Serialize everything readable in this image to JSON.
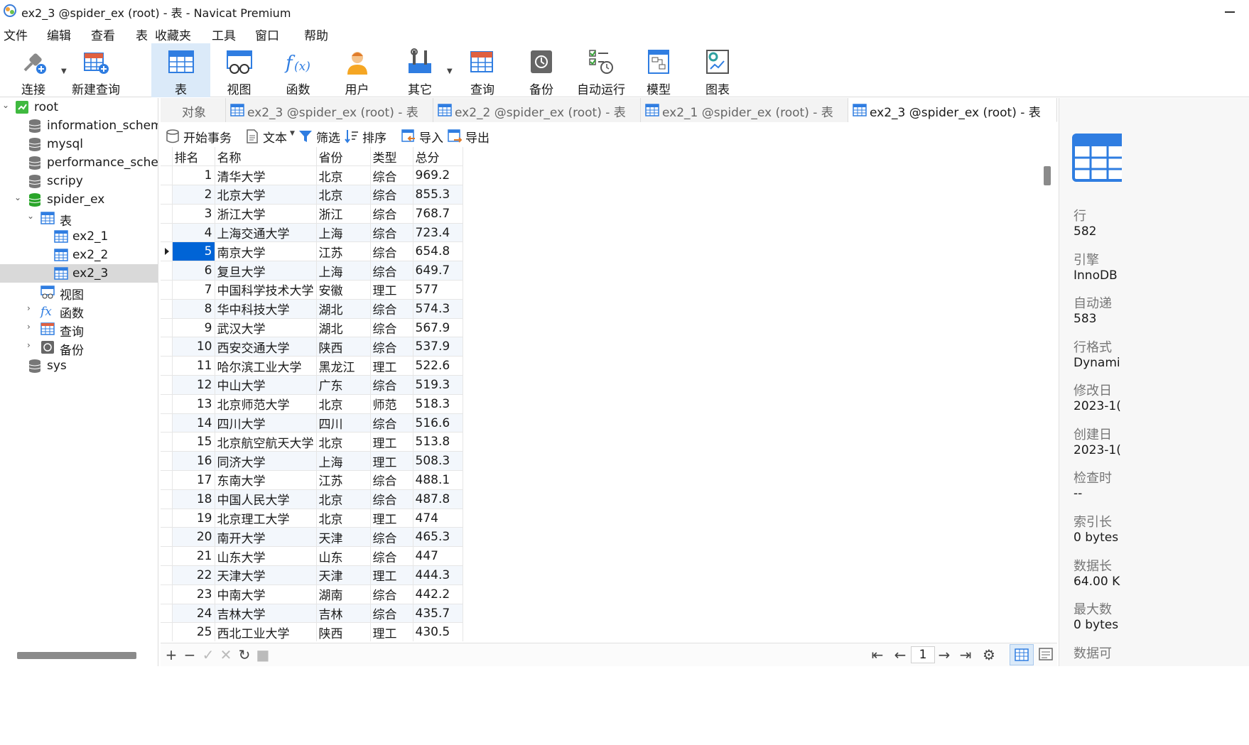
{
  "window": {
    "title": "ex2_3 @spider_ex (root) - 表 - Navicat Premium"
  },
  "menu": [
    "文件",
    "编辑",
    "查看",
    "表",
    "收藏夹",
    "工具",
    "窗口",
    "帮助"
  ],
  "toolbar": {
    "connect": "连接",
    "new_query": "新建查询",
    "table": "表",
    "view": "视图",
    "function": "函数",
    "user": "用户",
    "other": "其它",
    "query": "查询",
    "backup": "备份",
    "automation": "自动运行",
    "model": "模型",
    "chart": "图表"
  },
  "tree": {
    "root": "root",
    "dbs": [
      "information_schema",
      "mysql",
      "performance_schema",
      "scripy"
    ],
    "spider_ex": "spider_ex",
    "tables_group": "表",
    "tables": [
      "ex2_1",
      "ex2_2",
      "ex2_3"
    ],
    "views": "视图",
    "functions": "函数",
    "queries": "查询",
    "backups": "备份",
    "sys": "sys"
  },
  "tabs": {
    "objects": "对象",
    "t1": "ex2_3 @spider_ex (root) - 表",
    "t2": "ex2_2 @spider_ex (root) - 表",
    "t3": "ex2_1 @spider_ex (root) - 表",
    "t4": "ex2_3 @spider_ex (root) - 表"
  },
  "subtoolbar": {
    "begin_tx": "开始事务",
    "text": "文本",
    "filter": "筛选",
    "sort": "排序",
    "import": "导入",
    "export": "导出"
  },
  "grid": {
    "columns": [
      "排名",
      "名称",
      "省份",
      "类型",
      "总分"
    ],
    "rows": [
      [
        "1",
        "清华大学",
        "北京",
        "综合",
        "969.2"
      ],
      [
        "2",
        "北京大学",
        "北京",
        "综合",
        "855.3"
      ],
      [
        "3",
        "浙江大学",
        "浙江",
        "综合",
        "768.7"
      ],
      [
        "4",
        "上海交通大学",
        "上海",
        "综合",
        "723.4"
      ],
      [
        "5",
        "南京大学",
        "江苏",
        "综合",
        "654.8"
      ],
      [
        "6",
        "复旦大学",
        "上海",
        "综合",
        "649.7"
      ],
      [
        "7",
        "中国科学技术大学",
        "安徽",
        "理工",
        "577"
      ],
      [
        "8",
        "华中科技大学",
        "湖北",
        "综合",
        "574.3"
      ],
      [
        "9",
        "武汉大学",
        "湖北",
        "综合",
        "567.9"
      ],
      [
        "10",
        "西安交通大学",
        "陕西",
        "综合",
        "537.9"
      ],
      [
        "11",
        "哈尔滨工业大学",
        "黑龙江",
        "理工",
        "522.6"
      ],
      [
        "12",
        "中山大学",
        "广东",
        "综合",
        "519.3"
      ],
      [
        "13",
        "北京师范大学",
        "北京",
        "师范",
        "518.3"
      ],
      [
        "14",
        "四川大学",
        "四川",
        "综合",
        "516.6"
      ],
      [
        "15",
        "北京航空航天大学",
        "北京",
        "理工",
        "513.8"
      ],
      [
        "16",
        "同济大学",
        "上海",
        "理工",
        "508.3"
      ],
      [
        "17",
        "东南大学",
        "江苏",
        "综合",
        "488.1"
      ],
      [
        "18",
        "中国人民大学",
        "北京",
        "综合",
        "487.8"
      ],
      [
        "19",
        "北京理工大学",
        "北京",
        "理工",
        "474"
      ],
      [
        "20",
        "南开大学",
        "天津",
        "综合",
        "465.3"
      ],
      [
        "21",
        "山东大学",
        "山东",
        "综合",
        "447"
      ],
      [
        "22",
        "天津大学",
        "天津",
        "理工",
        "444.3"
      ],
      [
        "23",
        "中南大学",
        "湖南",
        "综合",
        "442.2"
      ],
      [
        "24",
        "吉林大学",
        "吉林",
        "综合",
        "435.7"
      ],
      [
        "25",
        "西北工业大学",
        "陕西",
        "理工",
        "430.5"
      ]
    ]
  },
  "pager": {
    "page": "1"
  },
  "info": {
    "rows_label": "行",
    "rows_value": "582",
    "engine_label": "引擎",
    "engine_value": "InnoDB",
    "autoinc_label": "自动递",
    "autoinc_value": "583",
    "rowfmt_label": "行格式",
    "rowfmt_value": "Dynami",
    "modified_label": "修改日",
    "modified_value": "2023-1(",
    "created_label": "创建日",
    "created_value": "2023-1(",
    "check_label": "检查时",
    "check_value": "--",
    "index_label": "索引长",
    "index_value": "0 bytes",
    "data_label": "数据长",
    "data_value": "64.00 K",
    "maxdata_label": "最大数",
    "maxdata_value": "0 bytes",
    "datafree_label": "数据可"
  },
  "colors": {
    "accent": "#0064d6",
    "active_bg": "#dbeaf9",
    "selected_tree": "#d9d9d9"
  }
}
